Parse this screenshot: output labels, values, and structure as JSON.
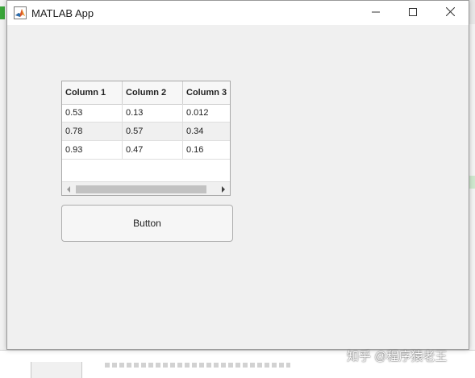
{
  "window": {
    "title": "MATLAB App"
  },
  "table": {
    "columns": [
      "Column 1",
      "Column 2",
      "Column 3"
    ],
    "rows": [
      [
        "0.53",
        "0.13",
        "0.012"
      ],
      [
        "0.78",
        "0.57",
        "0.34"
      ],
      [
        "0.93",
        "0.47",
        "0.16"
      ]
    ]
  },
  "button": {
    "label": "Button"
  },
  "watermark": {
    "text": "知乎 @程序猿老王"
  },
  "icons": {
    "app": "matlab-logo-icon",
    "minimize": "minimize-icon",
    "maximize": "maximize-icon",
    "close": "close-icon",
    "scroll_left": "chevron-left-icon",
    "scroll_right": "chevron-right-icon"
  },
  "colors": {
    "window_bg": "#f0f0f0",
    "titlebar_bg": "#ffffff",
    "table_border": "#a8a8a8",
    "alt_row": "#f0f0f0"
  }
}
